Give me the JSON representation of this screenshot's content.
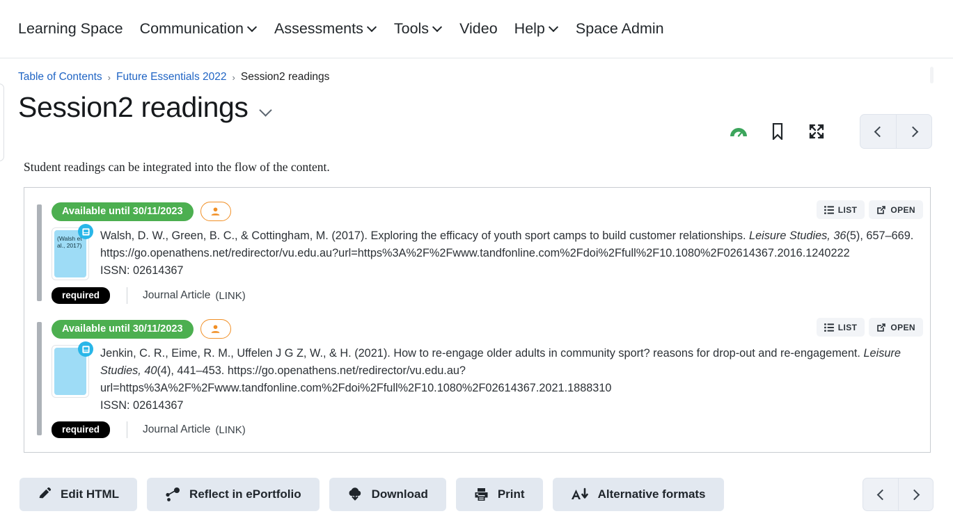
{
  "navbar": {
    "items": [
      {
        "label": "Learning Space",
        "has_caret": false
      },
      {
        "label": "Communication",
        "has_caret": true
      },
      {
        "label": "Assessments",
        "has_caret": true
      },
      {
        "label": "Tools",
        "has_caret": true
      },
      {
        "label": "Video",
        "has_caret": false
      },
      {
        "label": "Help",
        "has_caret": true
      },
      {
        "label": "Space Admin",
        "has_caret": false
      }
    ]
  },
  "breadcrumb": {
    "items": [
      {
        "label": "Table of Contents",
        "link": true
      },
      {
        "label": "Future Essentials 2022",
        "link": true
      },
      {
        "label": "Session2 readings",
        "link": false
      }
    ],
    "separator": "›"
  },
  "header": {
    "title": "Session2 readings",
    "icons": [
      {
        "name": "progress-gauge-icon",
        "color": "#3ca55c"
      },
      {
        "name": "bookmark-icon",
        "color": "#22272b"
      },
      {
        "name": "fullscreen-expand-icon",
        "color": "#22272b"
      }
    ],
    "pager": {
      "prev": "‹",
      "next": "›"
    }
  },
  "main": {
    "intro": "Student readings can be integrated into the flow of the content.",
    "readings": [
      {
        "availability": "Available until 30/11/2023",
        "person_badge": "person-icon",
        "buttons": [
          {
            "label": "LIST",
            "icon": "list-icon"
          },
          {
            "label": "OPEN",
            "icon": "external-link-icon"
          }
        ],
        "thumbnail_text": "(Walsh et al., 2017)",
        "thumbnail_color": "#9edcf6",
        "citation_part1": "Walsh, D. W., Green, B. C., & Cottingham, M. (2017). Exploring the efficacy of youth sport camps to build customer relationships. ",
        "citation_italic": "Leisure Studies, 36",
        "citation_part2": "(5), 657–669. https://go.openathens.net/redirector/vu.edu.au?url=https%3A%2F%2Fwww.tandfonline.com%2Fdoi%2Ffull%2F10.1080%2F02614367.2016.1240222",
        "issn": "ISSN: 02614367",
        "required_label": "required",
        "type_label": "Journal Article",
        "link_label": "(LINK)"
      },
      {
        "availability": "Available until 30/11/2023",
        "person_badge": "person-icon",
        "buttons": [
          {
            "label": "LIST",
            "icon": "list-icon"
          },
          {
            "label": "OPEN",
            "icon": "external-link-icon"
          }
        ],
        "thumbnail_text": "",
        "thumbnail_color": "#9edcf6",
        "citation_part1": "Jenkin, C. R., Eime, R. M., Uffelen J G Z, W., & H. (2021). How to re-engage older adults in community sport? reasons for drop-out and re-engagement. ",
        "citation_italic": "Leisure Studies, 40",
        "citation_part2": "(4), 441–453. https://go.openathens.net/redirector/vu.edu.au?url=https%3A%2F%2Fwww.tandfonline.com%2Fdoi%2Ffull%2F10.1080%2F02614367.2021.1888310",
        "issn": "ISSN: 02614367",
        "required_label": "required",
        "type_label": "Journal Article",
        "link_label": "(LINK)"
      }
    ]
  },
  "footer": {
    "buttons": [
      {
        "label": "Edit HTML",
        "icon": "pencil-icon"
      },
      {
        "label": "Reflect in ePortfolio",
        "icon": "share-nodes-icon"
      },
      {
        "label": "Download",
        "icon": "cloud-download-icon"
      },
      {
        "label": "Print",
        "icon": "printer-icon"
      },
      {
        "label": "Alternative formats",
        "icon": "accessibility-formats-icon"
      }
    ],
    "pager": {
      "prev": "‹",
      "next": "›"
    }
  }
}
